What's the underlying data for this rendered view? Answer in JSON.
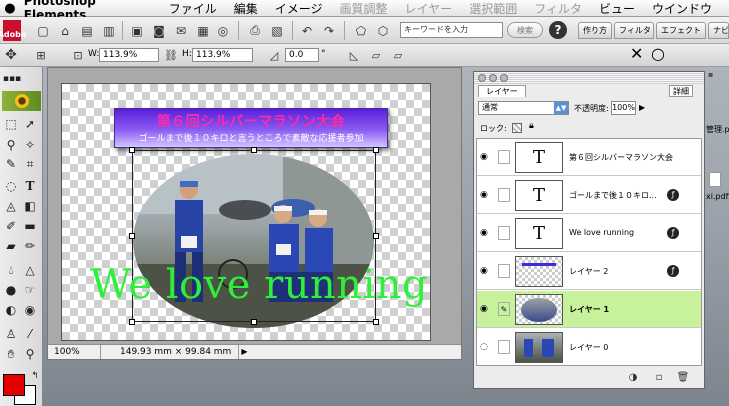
{
  "menubar": {
    "apple": "",
    "app_name": "Photoshop Elements",
    "items": [
      {
        "label": "ファイル",
        "dim": false
      },
      {
        "label": "編集",
        "dim": false
      },
      {
        "label": "イメージ",
        "dim": false
      },
      {
        "label": "画質調整",
        "dim": true
      },
      {
        "label": "レイヤー",
        "dim": true
      },
      {
        "label": "選択範囲",
        "dim": true
      },
      {
        "label": "フィルタ",
        "dim": true
      },
      {
        "label": "ビュー",
        "dim": false
      },
      {
        "label": "ウインドウ",
        "dim": false
      }
    ]
  },
  "toolbar": {
    "logo_text": "Adobe",
    "search_placeholder": "キーワードを入力",
    "search_button": "検索",
    "help": "?",
    "palette_tabs": [
      "作り方",
      "フィルタ",
      "エフェクト",
      "ナビ"
    ]
  },
  "options": {
    "w_label": "W:",
    "w_value": "113.9%",
    "h_label": "H:",
    "h_value": "113.9%",
    "angle_value": "0.0",
    "angle_unit": "°",
    "commit": "✕",
    "cancel": "○"
  },
  "document": {
    "banner_title": "第６回シルバーマラソン大会",
    "banner_subtitle": "ゴールまで後１０キロと言うところで素敵な応援者参加",
    "overlay_text": "We love running",
    "zoom": "100%",
    "size": "149.93 mm × 99.84 mm"
  },
  "layers_palette": {
    "tab": "レイヤー",
    "more": "詳細",
    "blend_mode": "通常",
    "opacity_label": "不透明度:",
    "opacity_value": "100%",
    "lock_label": "ロック:",
    "layers": [
      {
        "name": "第６回シルバーマラソン大会",
        "kind": "text",
        "thumb": "T",
        "active": false
      },
      {
        "name": "ゴールまで後１０キロ...",
        "kind": "text",
        "thumb": "T",
        "active": false
      },
      {
        "name": "We love running",
        "kind": "text",
        "thumb": "T",
        "active": false
      },
      {
        "name": "レイヤー 2",
        "kind": "pixel",
        "thumb": "",
        "active": false
      },
      {
        "name": "レイヤー 1",
        "kind": "photo",
        "thumb": "",
        "active": true
      },
      {
        "name": "レイヤー 0",
        "kind": "photo",
        "thumb": "",
        "active": false
      }
    ]
  },
  "desktop": {
    "label1": "管理.p",
    "label2": "xi.pdf"
  },
  "colors": {
    "foreground": "#e50000",
    "background": "#ffffff",
    "active_layer": "#c7f19a",
    "overlay_text": "#2ef03a",
    "banner_title": "#ff2aa8"
  }
}
